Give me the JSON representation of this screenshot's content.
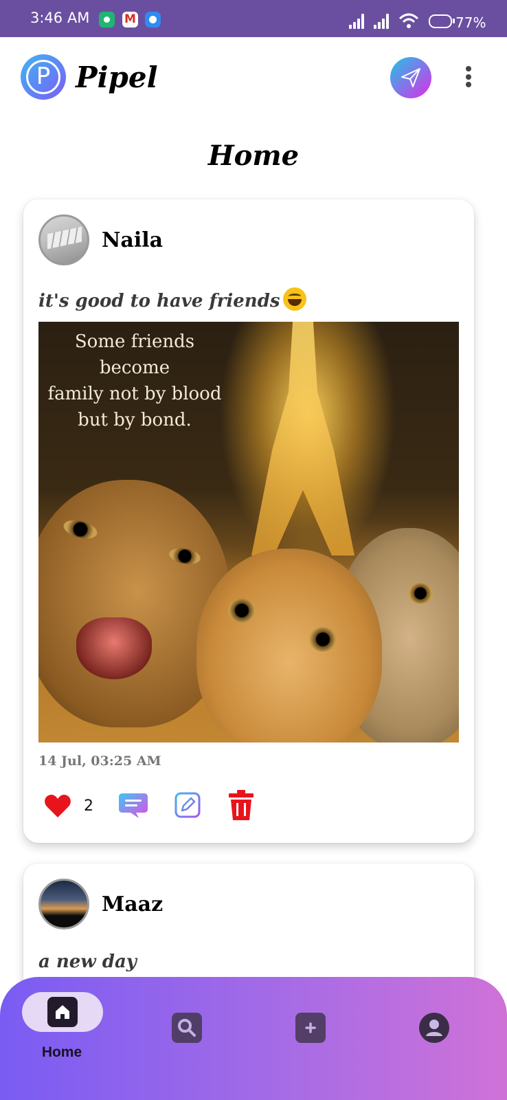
{
  "status_bar": {
    "time": "3:46 AM",
    "battery": "77%",
    "notification_icons": [
      "shield-app-icon",
      "gmail-icon",
      "messenger-icon"
    ]
  },
  "app": {
    "name": "Pipel",
    "logo_letter": "P",
    "brand_gradient": [
      "#3fb6f5",
      "#7a5cf5"
    ]
  },
  "header": {
    "page_title": "Home"
  },
  "posts": [
    {
      "author": "Naila",
      "caption": "it's good to have friends",
      "image_quote_lines": [
        "Some friends become",
        "family not by blood",
        "but by bond."
      ],
      "timestamp": "14 Jul, 03:25 AM",
      "likes": "2"
    },
    {
      "author": "Maaz",
      "caption": "a new day"
    }
  ],
  "bottom_nav": {
    "active": "Home",
    "items": [
      "home-icon",
      "search-icon",
      "add-post-icon",
      "profile-icon"
    ],
    "home_label": "Home",
    "gradient": [
      "#7a5cf3",
      "#cf72d8"
    ]
  }
}
